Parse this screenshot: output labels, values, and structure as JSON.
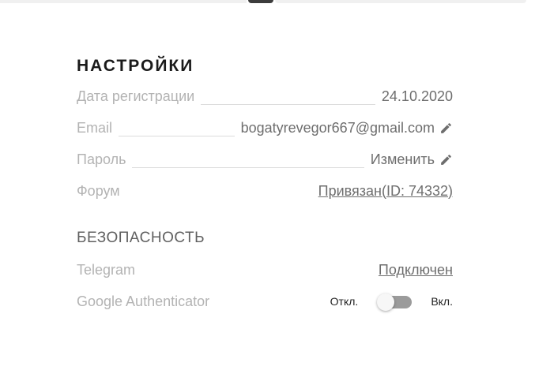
{
  "settings": {
    "title": "НАСТРОЙКИ",
    "rows": [
      {
        "label": "Дата регистрации",
        "value": "24.10.2020"
      },
      {
        "label": "Email",
        "value": "bogatyrevegor667@gmail.com",
        "icon": "pencil-icon"
      },
      {
        "label": "Пароль",
        "value": "Изменить",
        "icon": "pencil-icon"
      },
      {
        "label": "Форум",
        "value": "Привязан(ID: 74332)"
      }
    ]
  },
  "security": {
    "title": "БЕЗОПАСНОСТЬ",
    "telegram": {
      "label": "Telegram",
      "value": "Подключен"
    },
    "google_auth": {
      "label": "Google Authenticator",
      "off_label": "Откл.",
      "on_label": "Вкл.",
      "enabled": false
    }
  },
  "colors": {
    "label": "#b3b3b3",
    "value": "#6e6e6e",
    "toggle_track": "#9b9b9b"
  }
}
